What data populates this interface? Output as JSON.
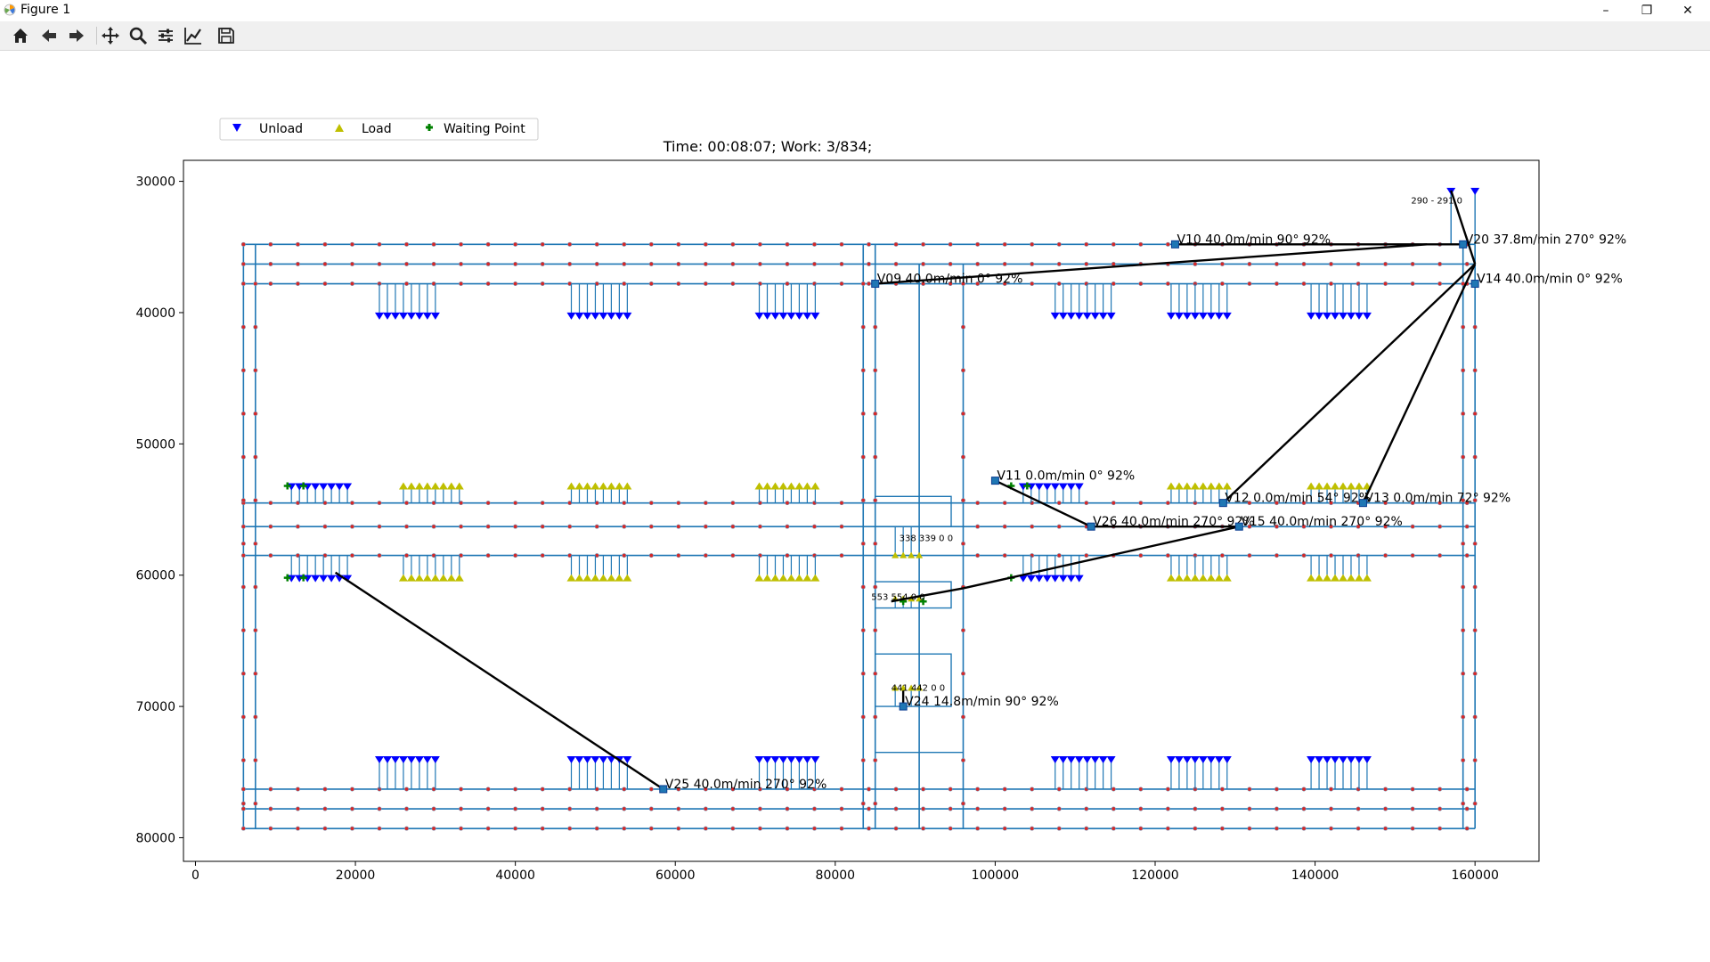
{
  "window": {
    "title": "Figure 1",
    "minimize_glyph": "–",
    "maximize_glyph": "❐",
    "close_glyph": "✕"
  },
  "toolbar": {
    "buttons": [
      {
        "name": "home-button",
        "icon": "home-icon"
      },
      {
        "name": "back-button",
        "icon": "arrow-left-icon"
      },
      {
        "name": "forward-button",
        "icon": "arrow-right-icon"
      },
      {
        "name": "pan-button",
        "icon": "move-icon"
      },
      {
        "name": "zoom-button",
        "icon": "zoom-icon"
      },
      {
        "name": "subplots-button",
        "icon": "sliders-icon"
      },
      {
        "name": "edit-axis-button",
        "icon": "line-chart-icon"
      },
      {
        "name": "save-button",
        "icon": "floppy-disk-icon"
      }
    ]
  },
  "plot": {
    "title": "Time: 00:08:07; Work: 3/834;",
    "legend": {
      "items": [
        {
          "label": "Unload",
          "marker": "triangle-down",
          "color": "#0000ff"
        },
        {
          "label": "Load",
          "marker": "triangle-up",
          "color": "#bfbf00"
        },
        {
          "label": "Waiting Point",
          "marker": "plus",
          "color": "#008000"
        }
      ]
    },
    "colors": {
      "track": "#1f77b4",
      "node": "#d62728",
      "path": "#000000",
      "vehicle": "#1f77b4"
    }
  },
  "chart_data": {
    "type": "scatter",
    "title": "Time: 00:08:07; Work: 3/834;",
    "xlim": [
      -1500,
      168000
    ],
    "ylim": [
      81800,
      28400
    ],
    "y_inverted": true,
    "x_ticks": [
      0,
      20000,
      40000,
      60000,
      80000,
      100000,
      120000,
      140000,
      160000
    ],
    "y_ticks": [
      30000,
      40000,
      50000,
      60000,
      70000,
      80000
    ],
    "legend_position": "upper-left outside",
    "grid": false,
    "horizontal_tracks_y": [
      34800,
      36300,
      37800,
      54500,
      56300,
      58500,
      76300,
      77800,
      79300
    ],
    "vertical_tracks_x": [
      6000,
      7500,
      83500,
      85000,
      90500,
      96000,
      158500,
      160000
    ],
    "vehicles": [
      {
        "label": "V09 40.0m/min 0° 92%",
        "x": 85000,
        "y": 37800
      },
      {
        "label": "V10 40.0m/min 90° 92%",
        "x": 122500,
        "y": 34800
      },
      {
        "label": "V20 37.8m/min 270° 92%",
        "x": 158500,
        "y": 34800
      },
      {
        "label": "V14 40.0m/min 0° 92%",
        "x": 160000,
        "y": 37800
      },
      {
        "label": "V11 0.0m/min 0° 92%",
        "x": 100000,
        "y": 52800
      },
      {
        "label": "V12 0.0m/min 54° 92%",
        "x": 128500,
        "y": 54500
      },
      {
        "label": "V13 0.0m/min 72° 92%",
        "x": 146000,
        "y": 54500
      },
      {
        "label": "V26 40.0m/min 270° 92%",
        "x": 112000,
        "y": 56300
      },
      {
        "label": "V15 40.0m/min 270° 92%",
        "x": 130500,
        "y": 56300
      },
      {
        "label": "V24 14.8m/min 90° 92%",
        "x": 88500,
        "y": 70000
      },
      {
        "label": "V25 40.0m/min 270° 92%",
        "x": 58500,
        "y": 76300
      }
    ],
    "station_labels": [
      "290 - 291 0",
      "338 339 0 0",
      "441 442 0 0",
      "553 554 0 0"
    ]
  }
}
